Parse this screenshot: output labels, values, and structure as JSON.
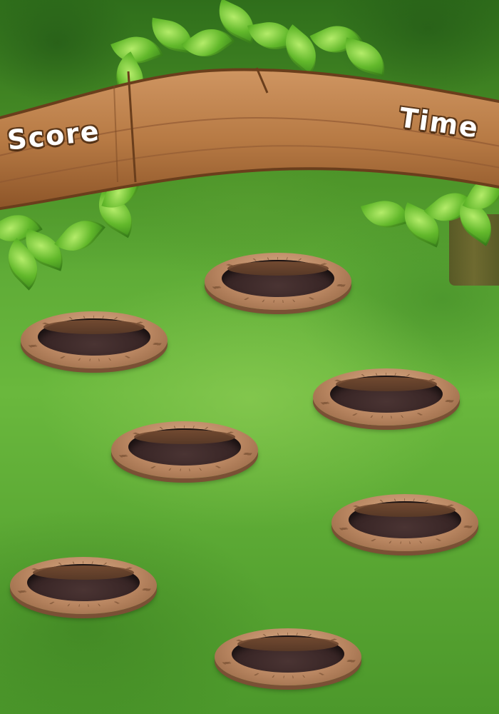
{
  "hud": {
    "score_label": "Score",
    "time_label": "Time"
  },
  "colors": {
    "grass": "#5aa634",
    "wood": "#b77a44",
    "hole_rim": "#b88560",
    "hole_pit": "#3a2727",
    "label_text": "#ffffff",
    "label_outline": "#5a3618"
  },
  "holes": [
    {
      "id": "hole-1"
    },
    {
      "id": "hole-2"
    },
    {
      "id": "hole-3"
    },
    {
      "id": "hole-4"
    },
    {
      "id": "hole-5"
    },
    {
      "id": "hole-6"
    },
    {
      "id": "hole-7"
    }
  ]
}
